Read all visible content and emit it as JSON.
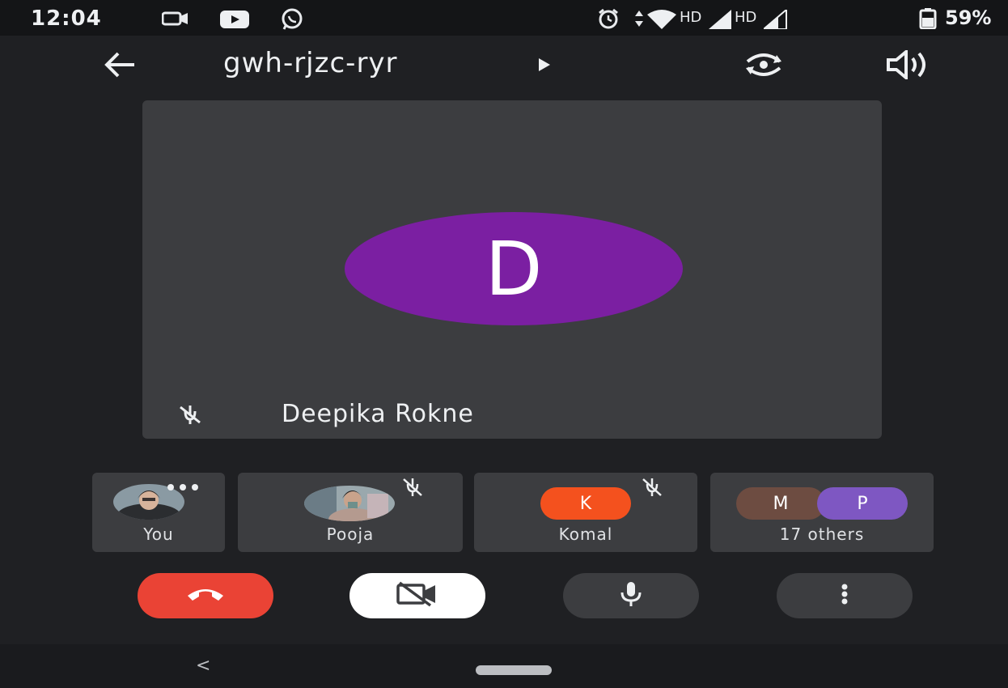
{
  "status_bar": {
    "time": "12:04",
    "left_icons": [
      "video-recorder-icon",
      "youtube-icon",
      "whatsapp-icon"
    ],
    "right_icons": [
      "alarm-icon",
      "data-arrows-icon",
      "wifi-icon",
      "signal-icon",
      "signal-icon",
      "battery-icon"
    ],
    "hd_label_1": "HD",
    "hd_label_2": "HD",
    "battery_percent": "59%"
  },
  "top_bar": {
    "meeting_code": "gwh-rjzc-ryr",
    "icons": [
      "back-arrow-icon",
      "play-arrow-icon",
      "switch-camera-icon",
      "speaker-icon"
    ]
  },
  "main_tile": {
    "avatar_initial": "D",
    "avatar_color": "#7b1fa2",
    "participant_name": "Deepika Rokne",
    "muted": true
  },
  "participants": [
    {
      "label": "You",
      "avatar": "photo",
      "muted": false,
      "has_menu": true
    },
    {
      "label": "Pooja",
      "avatar": "photo",
      "muted": true
    },
    {
      "label": "Komal",
      "avatar_initial": "K",
      "avatar_color": "#f4511e",
      "muted": true
    },
    {
      "label": "17 others",
      "avatars": [
        {
          "initial": "M",
          "color": "#6d4c41"
        },
        {
          "initial": "P",
          "color": "#7e57c2"
        }
      ]
    }
  ],
  "controls": {
    "end_call": {
      "icon": "end-call-icon",
      "color": "#ea4335"
    },
    "camera": {
      "icon": "camera-off-icon",
      "color": "#ffffff"
    },
    "microphone": {
      "icon": "microphone-icon",
      "color": "#3c3d40"
    },
    "more": {
      "icon": "more-vert-icon",
      "color": "#3c3d40"
    }
  },
  "nav_bar": {
    "back_glyph": "<"
  }
}
